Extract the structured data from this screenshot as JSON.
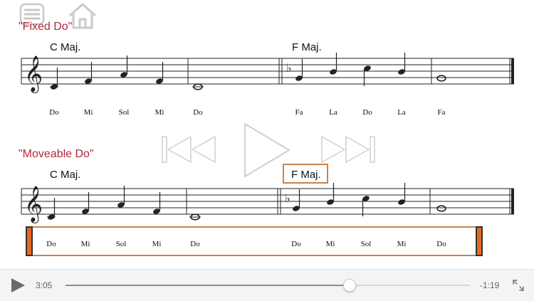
{
  "sections": [
    {
      "title": "\"Fixed Do\"",
      "key_left": "C Maj.",
      "key_right": "F Maj.",
      "syllables": [
        "Do",
        "Mi",
        "Sol",
        "Mi",
        "Do",
        "Fa",
        "La",
        "Do",
        "La",
        "Fa"
      ]
    },
    {
      "title": "\"Moveable Do\"",
      "key_left": "C Maj.",
      "key_right": "F Maj.",
      "syllables": [
        "Do",
        "Mi",
        "Sol",
        "Mi",
        "Do",
        "Do",
        "Mi",
        "Sol",
        "Mi",
        "Do"
      ]
    }
  ],
  "player": {
    "elapsed": "3:05",
    "remaining": "-1:19",
    "progress_fraction": 0.7
  },
  "icons": {
    "menu": "list-icon",
    "home": "home-icon",
    "rewind": "skip-back-icon",
    "play_overlay": "play-icon",
    "forward": "skip-forward-icon",
    "play_bar": "play-icon",
    "fullscreen": "expand-icon"
  },
  "colors": {
    "title": "#b0283a",
    "highlight_border": "#c8834d",
    "highlight_cap": "#e46a1b"
  }
}
